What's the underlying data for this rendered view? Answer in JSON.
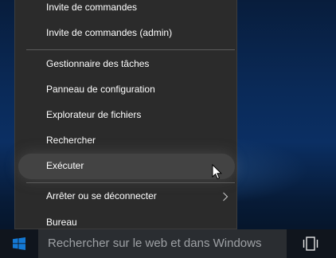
{
  "taskbar": {
    "search_placeholder": "Rechercher sur le web et dans Windows",
    "start_icon": "windows-logo-icon",
    "task_view_icon": "task-view-icon"
  },
  "winx_menu": {
    "items": [
      {
        "label": "Invite de commandes"
      },
      {
        "label": "Invite de commandes (admin)"
      },
      {
        "label": "Gestionnaire des tâches"
      },
      {
        "label": "Panneau de configuration"
      },
      {
        "label": "Explorateur de fichiers"
      },
      {
        "label": "Rechercher"
      },
      {
        "label": "Exécuter",
        "state": "hovered"
      },
      {
        "label": "Arrêter ou se déconnecter",
        "has_submenu": true
      },
      {
        "label": "Bureau"
      }
    ]
  },
  "colors": {
    "menu_background": "#2b2b2b",
    "menu_hover": "#434343",
    "taskbar": "#10151d",
    "search_box": "#2a2d31",
    "windows_blue": "#1479d4"
  }
}
